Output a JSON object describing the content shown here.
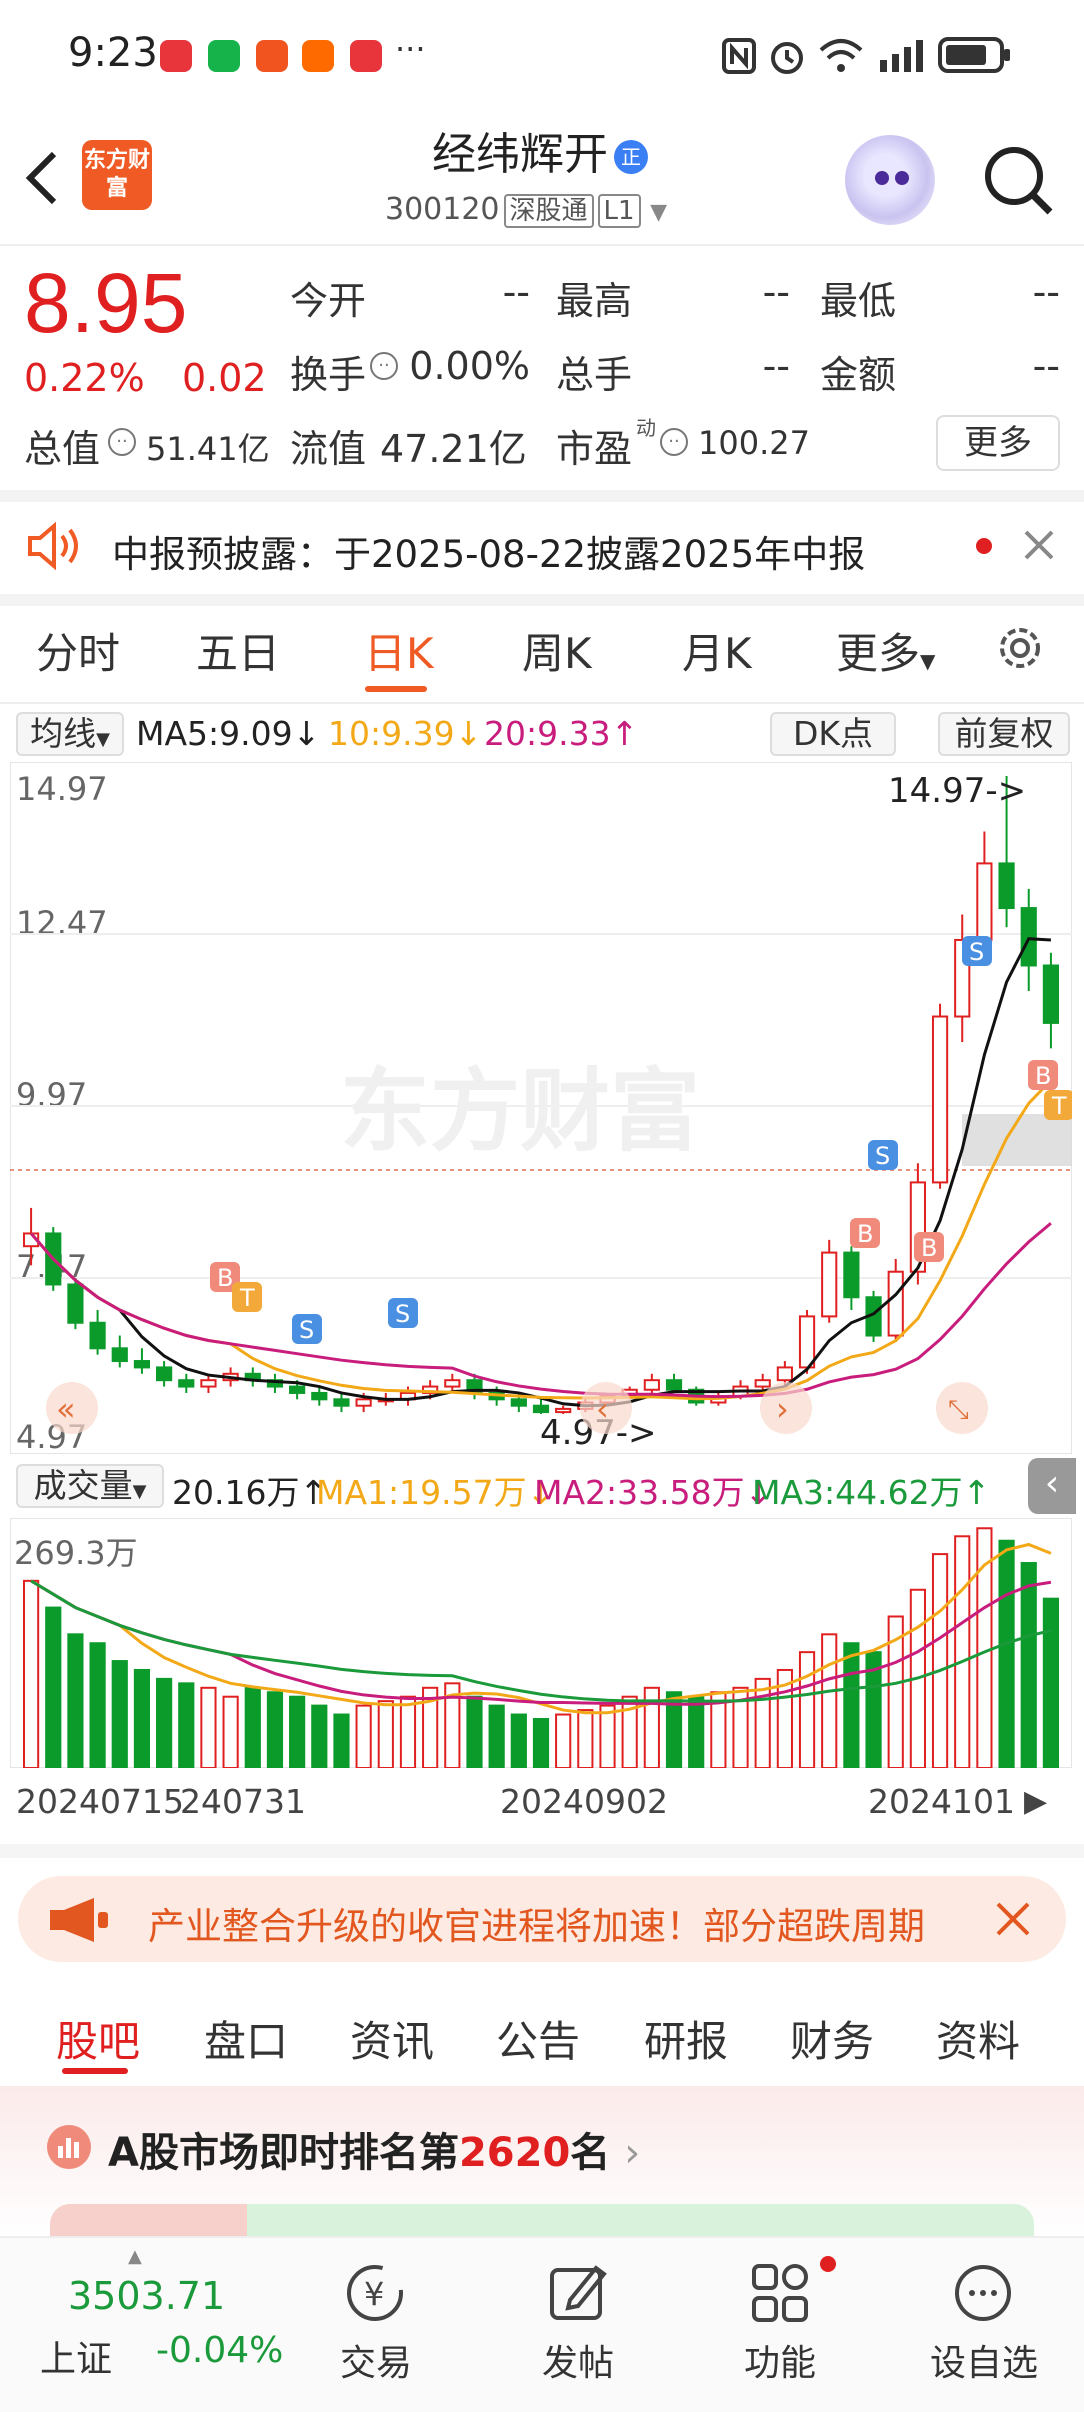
{
  "status_bar": {
    "time": "9:23",
    "more": "···"
  },
  "header": {
    "logo_text": "东方财富",
    "title": "经纬辉开",
    "title_badge": "正",
    "code": "300120",
    "tag_market": "深股通",
    "tag_level": "L1"
  },
  "quote": {
    "price": "8.95",
    "change_pct": "0.22%",
    "change": "0.02",
    "open_label": "今开",
    "open_val": "--",
    "high_label": "最高",
    "high_val": "--",
    "low_label": "最低",
    "low_val": "--",
    "turnover_label": "换手",
    "turnover_val": "0.00%",
    "volume_label": "总手",
    "volume_val": "--",
    "amount_label": "金额",
    "amount_val": "--",
    "mktcap_label": "总值",
    "mktcap_val": "51.41亿",
    "float_label": "流值",
    "float_val": "47.21亿",
    "pe_label": "市盈",
    "pe_sup": "动",
    "pe_val": "100.27",
    "more_button": "更多"
  },
  "notice": {
    "text": "中报预披露：于2025-08-22披露2025年中报"
  },
  "tabs": [
    "分时",
    "五日",
    "日K",
    "周K",
    "月K",
    "更多"
  ],
  "chart": {
    "indicator_select": "均线",
    "ma5": "MA5:9.09",
    "ma10": "10:9.39",
    "ma20": "20:9.33",
    "dk_button": "DK点",
    "adjust_button": "前复权",
    "y_ticks": [
      "14.97",
      "12.47",
      "9.97",
      "7.47",
      "4.97"
    ],
    "max_marker": "14.97->",
    "min_marker": "4.97->",
    "watermark": "东方财富",
    "volume_select": "成交量",
    "vol_val": "20.16万",
    "vol_ma1": "MA1:19.57万",
    "vol_ma2": "MA2:33.58万",
    "vol_ma3": "MA3:44.62万",
    "vol_max": "269.3万",
    "dates": [
      "20240715",
      "240731",
      "20240902",
      "2024101"
    ]
  },
  "chart_data": {
    "type": "candlestick",
    "ylim": [
      4.97,
      14.97
    ],
    "candles": [
      [
        7.6,
        8.2,
        7.3,
        7.8
      ],
      [
        7.8,
        7.9,
        6.9,
        7.0
      ],
      [
        7.0,
        7.1,
        6.3,
        6.4
      ],
      [
        6.4,
        6.6,
        5.9,
        6.0
      ],
      [
        6.0,
        6.2,
        5.7,
        5.8
      ],
      [
        5.8,
        6.0,
        5.6,
        5.7
      ],
      [
        5.7,
        5.8,
        5.4,
        5.5
      ],
      [
        5.5,
        5.6,
        5.3,
        5.4
      ],
      [
        5.4,
        5.6,
        5.3,
        5.5
      ],
      [
        5.5,
        5.7,
        5.4,
        5.6
      ],
      [
        5.6,
        5.7,
        5.4,
        5.5
      ],
      [
        5.5,
        5.6,
        5.3,
        5.4
      ],
      [
        5.4,
        5.5,
        5.2,
        5.3
      ],
      [
        5.3,
        5.4,
        5.1,
        5.2
      ],
      [
        5.2,
        5.3,
        5.0,
        5.1
      ],
      [
        5.1,
        5.3,
        5.0,
        5.2
      ],
      [
        5.2,
        5.3,
        5.1,
        5.2
      ],
      [
        5.2,
        5.4,
        5.1,
        5.3
      ],
      [
        5.3,
        5.5,
        5.2,
        5.4
      ],
      [
        5.4,
        5.6,
        5.3,
        5.5
      ],
      [
        5.5,
        5.6,
        5.2,
        5.3
      ],
      [
        5.3,
        5.4,
        5.1,
        5.2
      ],
      [
        5.2,
        5.3,
        5.0,
        5.1
      ],
      [
        5.1,
        5.2,
        4.97,
        5.0
      ],
      [
        5.0,
        5.1,
        4.97,
        5.05
      ],
      [
        5.05,
        5.2,
        5.0,
        5.15
      ],
      [
        5.15,
        5.3,
        5.1,
        5.25
      ],
      [
        5.25,
        5.4,
        5.2,
        5.35
      ],
      [
        5.35,
        5.6,
        5.3,
        5.5
      ],
      [
        5.5,
        5.6,
        5.3,
        5.35
      ],
      [
        5.35,
        5.4,
        5.1,
        5.15
      ],
      [
        5.15,
        5.3,
        5.1,
        5.25
      ],
      [
        5.25,
        5.5,
        5.2,
        5.4
      ],
      [
        5.4,
        5.6,
        5.3,
        5.5
      ],
      [
        5.5,
        5.8,
        5.4,
        5.7
      ],
      [
        5.7,
        6.6,
        5.6,
        6.5
      ],
      [
        6.5,
        7.7,
        6.4,
        7.5
      ],
      [
        7.5,
        7.6,
        6.6,
        6.8
      ],
      [
        6.8,
        6.9,
        6.1,
        6.2
      ],
      [
        6.2,
        7.4,
        6.1,
        7.2
      ],
      [
        7.2,
        8.9,
        7.0,
        8.6
      ],
      [
        8.6,
        11.4,
        8.5,
        11.2
      ],
      [
        11.2,
        12.8,
        10.8,
        12.4
      ],
      [
        12.4,
        14.1,
        12.0,
        13.6
      ],
      [
        13.6,
        14.97,
        12.6,
        12.9
      ],
      [
        12.9,
        13.2,
        11.6,
        12.0
      ],
      [
        12.0,
        12.2,
        10.7,
        11.1
      ]
    ],
    "volume": [
      210,
      180,
      150,
      140,
      120,
      110,
      100,
      95,
      90,
      80,
      90,
      85,
      80,
      70,
      60,
      70,
      75,
      80,
      90,
      95,
      80,
      70,
      60,
      55,
      60,
      65,
      70,
      80,
      90,
      85,
      80,
      85,
      90,
      100,
      110,
      130,
      150,
      140,
      130,
      170,
      200,
      240,
      260,
      269,
      255,
      230,
      190
    ]
  }
}
